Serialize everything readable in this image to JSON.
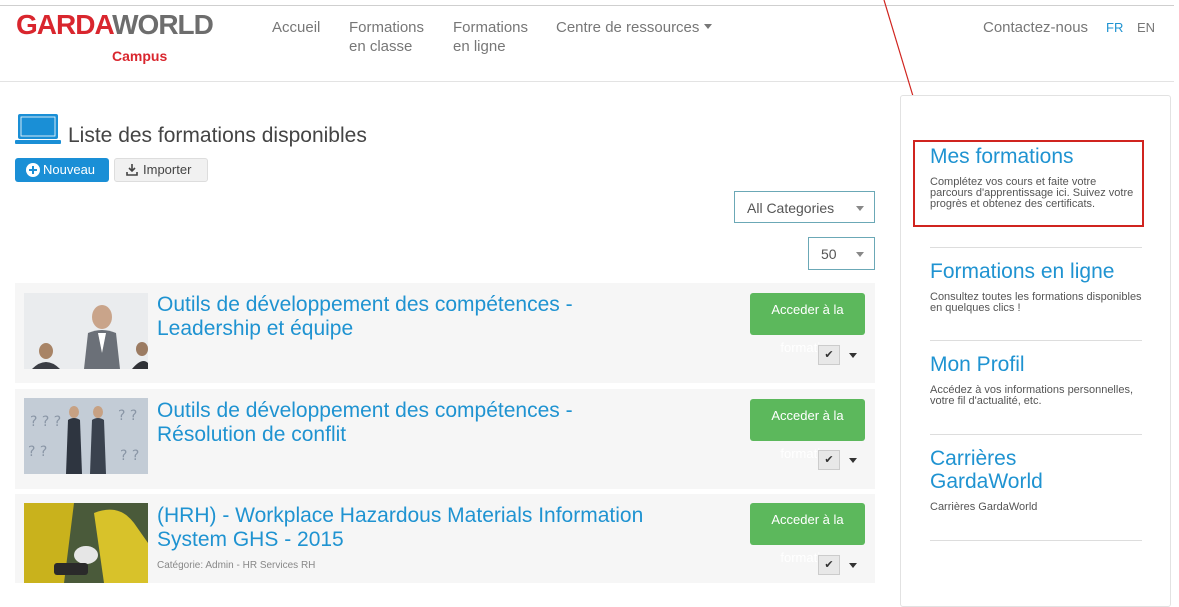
{
  "brand": {
    "name_part1": "GARDA",
    "name_part2": "WORLD",
    "subtitle": "Campus"
  },
  "nav": {
    "home": "Accueil",
    "classroom_line1": "Formations",
    "classroom_line2": "en classe",
    "online_line1": "Formations",
    "online_line2": "en ligne",
    "resources": "Centre de ressources",
    "contact": "Contactez-nous",
    "lang_fr": "FR",
    "lang_en": "EN"
  },
  "page": {
    "title": "Liste des formations disponibles",
    "new_button": "Nouveau",
    "import_button": "Importer",
    "category_filter": "All Categories",
    "page_size": "50"
  },
  "courses": [
    {
      "title_line1": "Outils de développement des compétences -",
      "title_line2": "Leadership et équipe",
      "category": "",
      "action": "Acceder à la formation"
    },
    {
      "title_line1": "Outils de développement des compétences -",
      "title_line2": "Résolution de conflit",
      "category": "",
      "action": "Acceder à la formation"
    },
    {
      "title_line1": "(HRH) - Workplace Hazardous Materials Information",
      "title_line2": "System GHS - 2015",
      "category": "Catégorie: Admin - HR Services RH",
      "action": "Acceder à la formation"
    }
  ],
  "action_label_line1": "Acceder à la",
  "action_label_line2": "formation",
  "sidebar": [
    {
      "heading": "Mes formations",
      "description": "Complétez vos cours et faite votre parcours d'apprentissage ici. Suivez votre progrès et obtenez des certificats."
    },
    {
      "heading": "Formations en ligne",
      "description": "Consultez toutes les formations disponibles en quelques clics !"
    },
    {
      "heading": "Mon Profil",
      "description": "Accédez à vos informations personnelles, votre fil d'actualité, etc."
    },
    {
      "heading_line1": "Carrières",
      "heading_line2": "GardaWorld",
      "description": "Carrières GardaWorld"
    }
  ],
  "colors": {
    "brand_red": "#d9262e",
    "link_blue": "#1f93d1",
    "primary_blue": "#1a8fd6",
    "success_green": "#5cb85c",
    "annotation_red": "#d0241f"
  },
  "icons": {
    "new": "plus-circle-icon",
    "import": "download-icon",
    "title": "laptop-icon",
    "check": "check-icon",
    "caret": "caret-down-icon"
  }
}
